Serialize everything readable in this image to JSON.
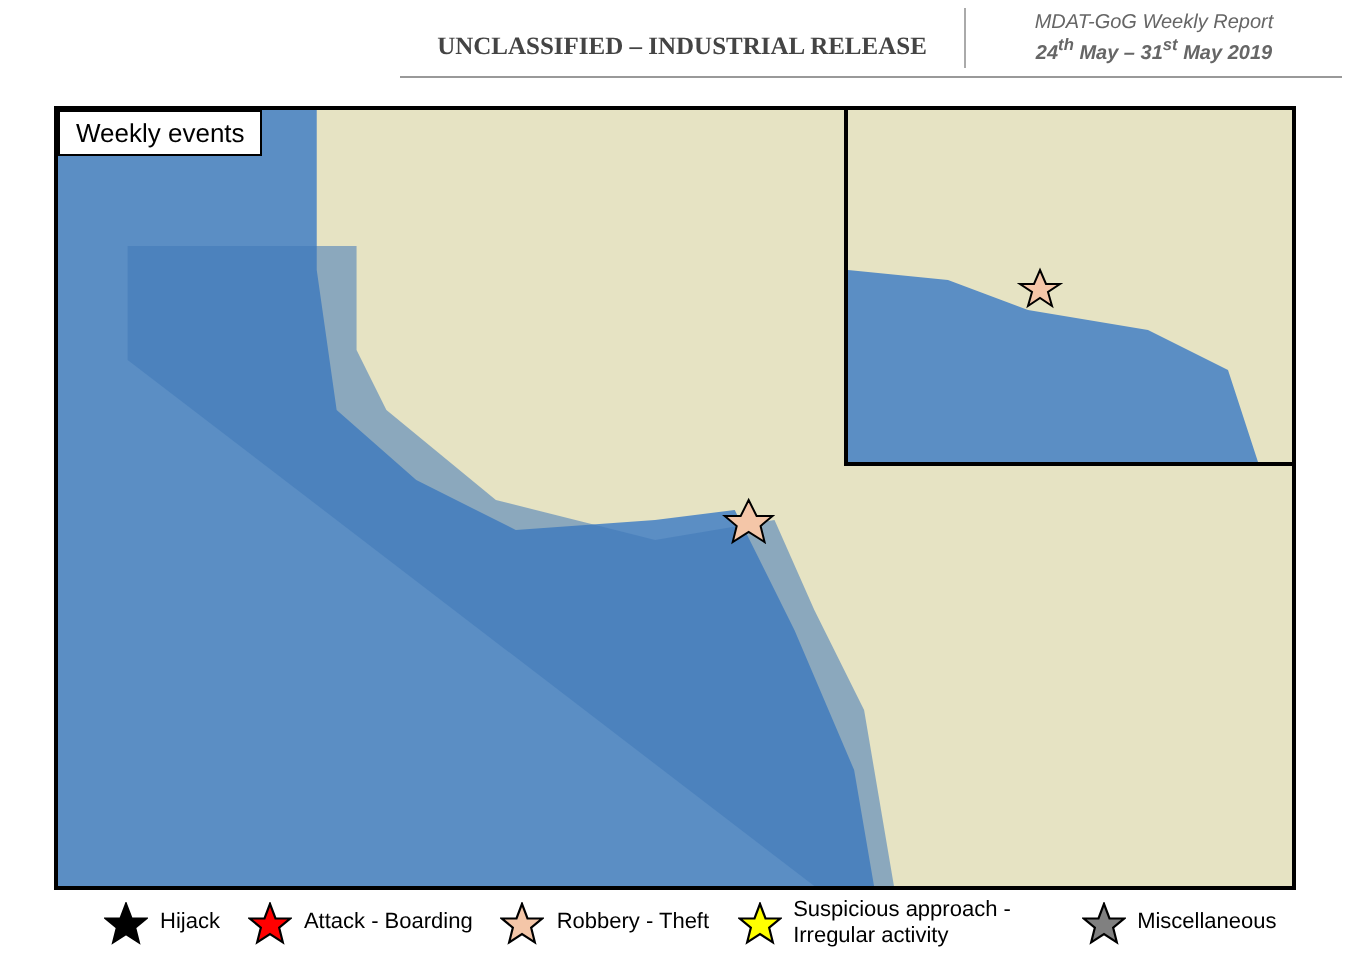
{
  "header": {
    "classification": "UNCLASSIFIED – INDUSTRIAL RELEASE",
    "report_title": "MDAT-GoG Weekly Report",
    "date_range": "24$^{th}$ May – 31$^{st}$ May 2019"
  },
  "map": {
    "title": "Weekly events"
  },
  "legend": [
    {
      "label": "Hijack",
      "color": "#000000"
    },
    {
      "label": "Attack - Boarding",
      "color": "#ff0000"
    },
    {
      "label": "Robbery - Theft",
      "color": "#f4c6a8"
    },
    {
      "label": "Suspicious approach - Irregular activity",
      "color": "#ffff00"
    },
    {
      "label": "Miscellaneous",
      "color": "#808080"
    }
  ]
}
